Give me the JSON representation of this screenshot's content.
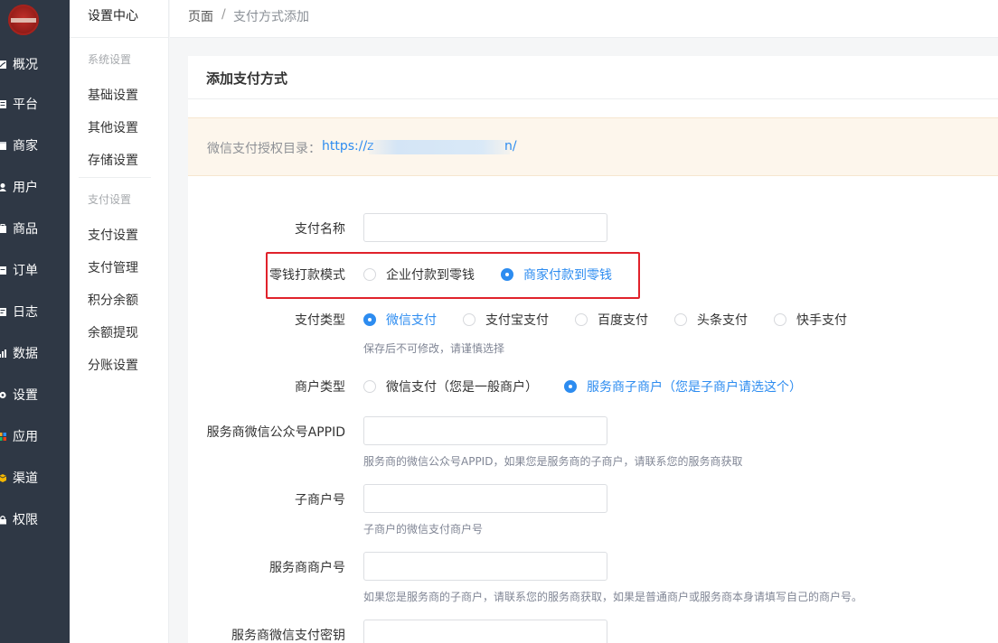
{
  "colors": {
    "nav_bg": "#2f3845",
    "accent": "#2d8cf0",
    "notice_bg": "#fdf6ec",
    "highlight_box": "#e0222b"
  },
  "nav": {
    "items": [
      {
        "label": "概况",
        "icon": "chart-icon"
      },
      {
        "label": "平台",
        "icon": "platform-icon"
      },
      {
        "label": "商家",
        "icon": "store-icon"
      },
      {
        "label": "用户",
        "icon": "user-icon"
      },
      {
        "label": "商品",
        "icon": "goods-icon"
      },
      {
        "label": "订单",
        "icon": "order-icon"
      },
      {
        "label": "日志",
        "icon": "log-icon"
      },
      {
        "label": "数据",
        "icon": "data-icon"
      },
      {
        "label": "设置",
        "icon": "gear-icon"
      },
      {
        "label": "应用",
        "icon": "apps-icon"
      },
      {
        "label": "渠道",
        "icon": "channel-icon"
      },
      {
        "label": "权限",
        "icon": "lock-icon"
      }
    ]
  },
  "subnav": {
    "title": "设置中心",
    "group1": "系统设置",
    "group1_items": [
      "基础设置",
      "其他设置",
      "存储设置"
    ],
    "group2": "支付设置",
    "group2_items": [
      "支付设置",
      "支付管理",
      "积分余额",
      "余额提现",
      "分账设置"
    ]
  },
  "breadcrumb": {
    "home": "页面",
    "sep": "/",
    "current": "支付方式添加"
  },
  "card": {
    "title": "添加支付方式",
    "notice_label": "微信支付授权目录：",
    "notice_url_start": "https://z",
    "notice_url_end": "n/"
  },
  "form": {
    "name_label": "支付名称",
    "name_value": "",
    "mode_label": "零钱打款模式",
    "mode_options": [
      "企业付款到零钱",
      "商家付款到零钱"
    ],
    "mode_selected": "商家付款到零钱",
    "type_label": "支付类型",
    "type_options": [
      "微信支付",
      "支付宝支付",
      "百度支付",
      "头条支付",
      "快手支付"
    ],
    "type_selected": "微信支付",
    "type_tip": "保存后不可修改，请谨慎选择",
    "merchant_label": "商户类型",
    "merchant_options": [
      "微信支付（您是一般商户）",
      "服务商子商户（您是子商户请选这个）"
    ],
    "merchant_selected": "服务商子商户（您是子商户请选这个）",
    "appid_label": "服务商微信公众号APPID",
    "appid_value": "",
    "appid_tip": "服务商的微信公众号APPID，如果您是服务商的子商户，请联系您的服务商获取",
    "submch_label": "子商户号",
    "submch_value": "",
    "submch_tip": "子商户的微信支付商户号",
    "sp_mch_label": "服务商商户号",
    "sp_mch_value": "",
    "sp_mch_tip": "如果您是服务商的子商户，请联系您的服务商获取，如果是普通商户或服务商本身请填写自己的商户号。",
    "sp_key_label": "服务商微信支付密钥",
    "sp_key_value": ""
  }
}
